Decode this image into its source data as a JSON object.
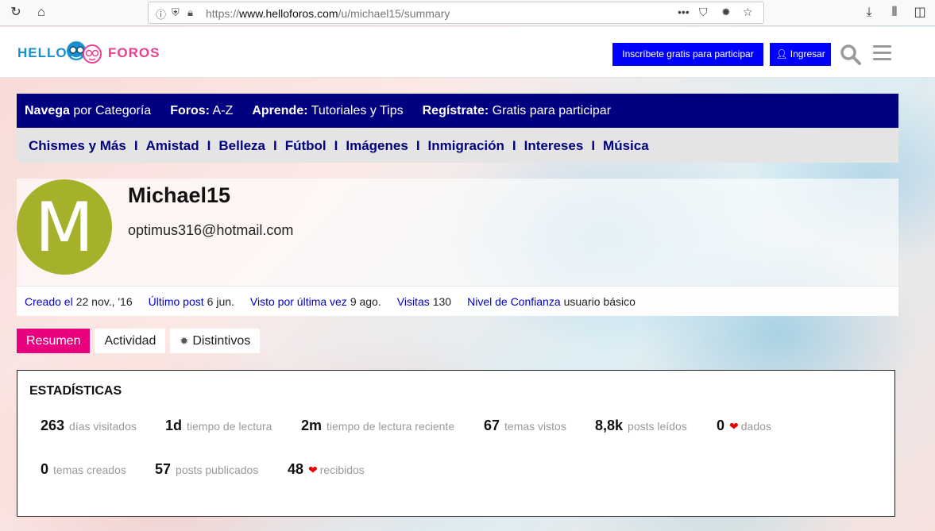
{
  "browser": {
    "url_scheme": "https://",
    "url_host": "www.helloforos.com",
    "url_path": "/u/michael15/summary",
    "url_more": "•••"
  },
  "header": {
    "logo_hello": "HELLO",
    "logo_foros": "FOROS",
    "signup_label": "Inscríbete gratis para participar",
    "login_label": "Ingresar",
    "login_icon": "user-icon"
  },
  "nav_primary": [
    {
      "bold": "Navega",
      "rest": " por Categoría"
    },
    {
      "bold": "Foros:",
      "rest": " A-Z"
    },
    {
      "bold": "Aprende:",
      "rest": " Tutoriales y Tips"
    },
    {
      "bold": "Regístrate:",
      "rest": " Gratis para participar"
    }
  ],
  "nav_categories": [
    "Chismes y Más",
    "Amistad",
    "Belleza",
    "Fútbol",
    "Imágenes",
    "Inmigración",
    "Intereses",
    "Música"
  ],
  "nav_separator": "I",
  "profile": {
    "avatar_letter": "M",
    "avatar_color": "#a5b12a",
    "username": "Michael15",
    "email": "optimus316@hotmail.com",
    "meta": [
      {
        "label": "Creado el",
        "value": "22 nov., '16"
      },
      {
        "label": "Último post",
        "value": "6 jun."
      },
      {
        "label": "Visto por última vez",
        "value": "9 ago."
      },
      {
        "label": "Visitas",
        "value": "130"
      },
      {
        "label": "Nivel de Confianza",
        "value": "usuario básico"
      }
    ]
  },
  "tabs": [
    {
      "label": "Resumen",
      "active": true
    },
    {
      "label": "Actividad",
      "active": false
    },
    {
      "label": "Distintivos",
      "active": false,
      "icon": "gear-icon"
    }
  ],
  "stats": {
    "title": "ESTADÍSTICAS",
    "row1": [
      {
        "num": "263",
        "label": "días visitados"
      },
      {
        "num": "1d",
        "label": "tiempo de lectura"
      },
      {
        "num": "2m",
        "label": "tiempo de lectura reciente"
      },
      {
        "num": "67",
        "label": "temas vistos"
      },
      {
        "num": "8,8k",
        "label": "posts leídos"
      },
      {
        "num": "0",
        "label": "dados",
        "heart": true
      }
    ],
    "row2": [
      {
        "num": "0",
        "label": "temas creados"
      },
      {
        "num": "57",
        "label": "posts publicados"
      },
      {
        "num": "48",
        "label": "recibidos",
        "heart": true
      }
    ]
  },
  "colors": {
    "nav_primary_bg": "#000080",
    "accent_pink": "#e9007f",
    "button_blue": "#0000ff"
  }
}
